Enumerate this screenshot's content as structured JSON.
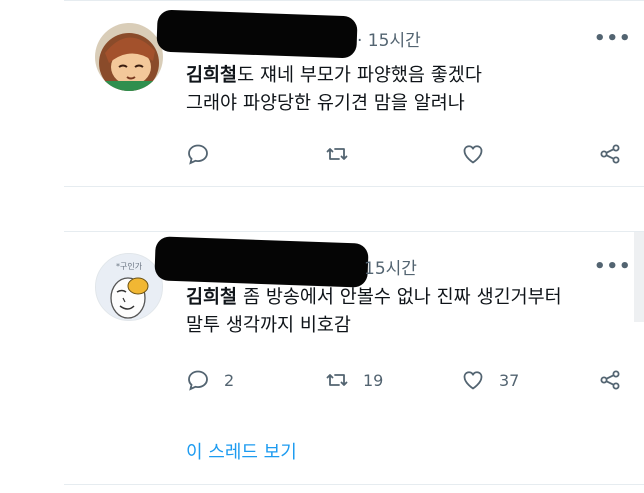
{
  "tweets": [
    {
      "time": "· 15시간",
      "author_in_text": "김희철",
      "line1_rest": "도 쟤네 부모가 파양했음 좋겠다",
      "line2": "그래야 파양당한 유기견 맘을 알려나",
      "reply_count": "",
      "retweet_count": "",
      "like_count": ""
    },
    {
      "time": "15시간",
      "author_in_text": "김희철",
      "line1_rest": " 좀 방송에서 안볼수 없나 진짜 생긴거부터",
      "line2": "말투 생각까지 비호감",
      "reply_count": "2",
      "retweet_count": "19",
      "like_count": "37",
      "avatar_caption": "*구인가"
    }
  ],
  "more_label": "•••",
  "thread_link": "이 스레드 보기",
  "colors": {
    "accent": "#1d9bf0",
    "muted": "#536471",
    "text": "#0f1419"
  },
  "icons": [
    "reply-icon",
    "retweet-icon",
    "like-icon",
    "share-icon",
    "more-icon"
  ]
}
